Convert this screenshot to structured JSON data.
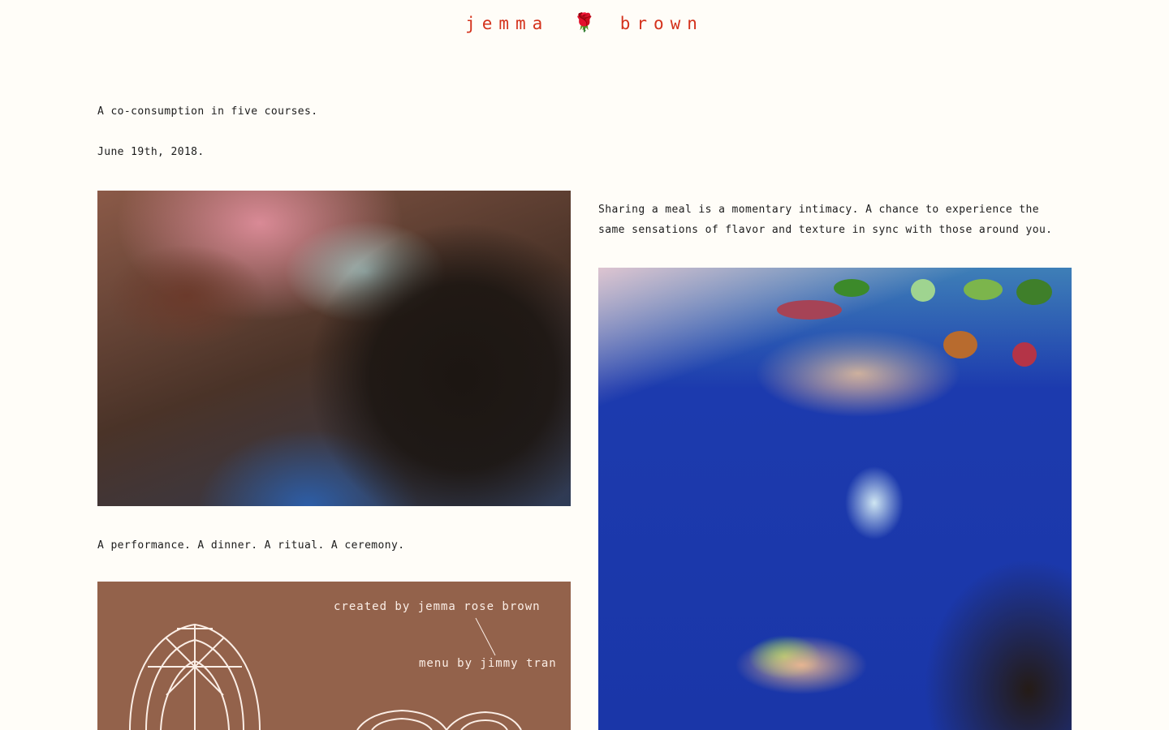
{
  "header": {
    "brand_first": "jemma",
    "brand_icon": "rose-icon",
    "brand_glyph": "🌹",
    "brand_last": "brown",
    "brand_color": "#d4321c"
  },
  "intro": {
    "line1": "A co-consumption in five courses.",
    "line2": "June 19th, 2018."
  },
  "captions": {
    "right": "Sharing a meal is a momentary intimacy. A chance to experience the same sensations of flavor and texture in sync with those around you.",
    "left": "A performance. A dinner. A ritual. A ceremony."
  },
  "menu_card": {
    "credit_creator": "created by jemma rose brown",
    "credit_menu": "menu by jimmy tran",
    "background": "#93624b"
  },
  "colors": {
    "page_background": "#fffdf8",
    "text": "#1c1c1c"
  }
}
